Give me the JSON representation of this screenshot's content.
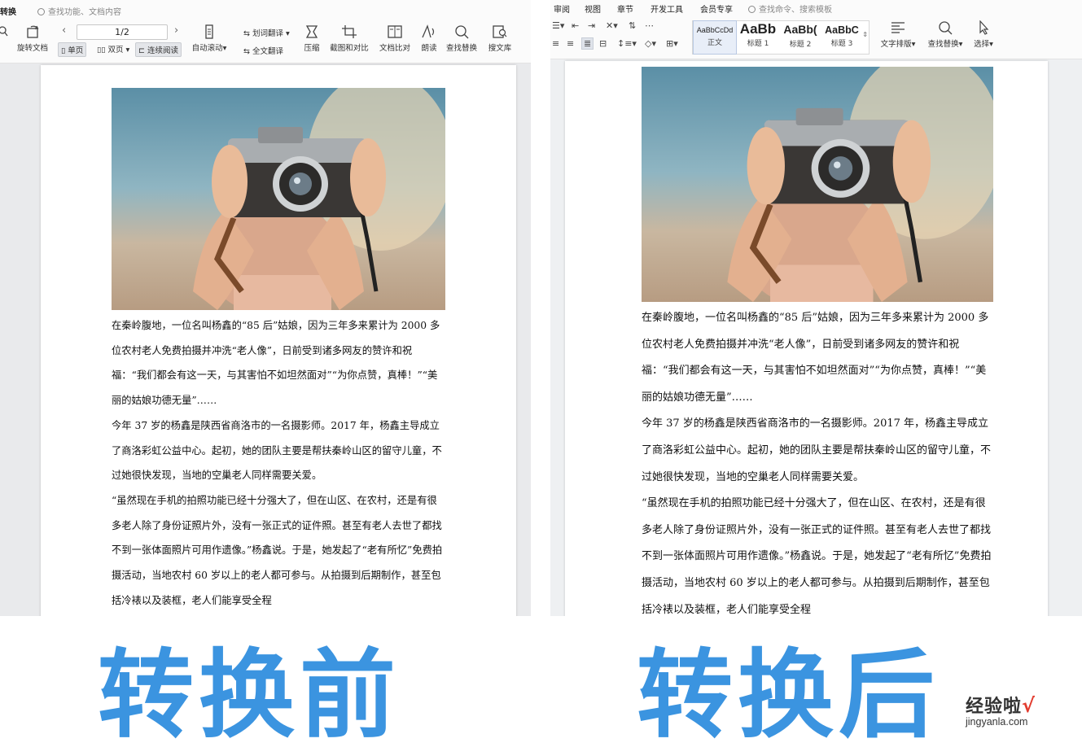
{
  "left": {
    "menu": {
      "convert_tab": "转换"
    },
    "search": {
      "placeholder": "查找功能、文档内容"
    },
    "page_indicator": "1/2",
    "tools": {
      "rotate": "旋转文档",
      "single_page": "单页",
      "double_page": "双页",
      "continuous": "连续阅读",
      "auto_scroll": "自动滚动",
      "word_translate": "划词翻译",
      "full_translate": "全文翻译",
      "compress": "压缩",
      "screenshot_compare": "截图和对比",
      "doc_compare": "文档比对",
      "read_aloud": "朗读",
      "find_replace": "查找替换",
      "search_library": "搜文库"
    },
    "icons": [
      "zoom-icon",
      "rotate-doc-icon",
      "prev-page-icon",
      "next-page-icon",
      "single-page-icon",
      "double-page-icon",
      "continuous-read-icon",
      "auto-scroll-icon",
      "word-translate-icon",
      "full-translate-icon",
      "compress-icon",
      "screenshot-compare-icon",
      "doc-compare-icon",
      "read-aloud-icon",
      "find-replace-icon",
      "search-library-icon"
    ]
  },
  "right": {
    "menu": {
      "review": "审阅",
      "view": "视图",
      "chapter": "章节",
      "developer": "开发工具",
      "member": "会员专享"
    },
    "search": {
      "placeholder": "查找命令、搜索模板"
    },
    "styles": [
      {
        "sample": "AaBbCcDd",
        "name": "正文"
      },
      {
        "sample": "AaBb",
        "name": "标题 1"
      },
      {
        "sample": "AaBb(",
        "name": "标题 2"
      },
      {
        "sample": "AaBbC",
        "name": "标题 3"
      }
    ],
    "tools": {
      "text_layout": "文字排版",
      "find_replace": "查找替换",
      "select": "选择"
    },
    "icons": [
      "bullet-list-icon",
      "numbered-list-icon",
      "decrease-indent-icon",
      "increase-indent-icon",
      "chinese-layout-icon",
      "sort-icon",
      "show-marks-icon",
      "align-left-icon",
      "align-center-icon",
      "align-right-icon",
      "justify-icon",
      "distributed-icon",
      "line-spacing-icon",
      "shading-icon",
      "border-icon",
      "text-layout-icon",
      "find-replace-icon",
      "select-cursor-icon"
    ]
  },
  "document": {
    "paragraphs": [
      "在秦岭腹地，一位名叫杨鑫的“85 后”姑娘，因为三年多来累计为 2000 多位农村老人免费拍摄并冲洗“老人像”，日前受到诸多网友的赞许和祝福：“我们都会有这一天，与其害怕不如坦然面对”“为你点赞，真棒！”“美丽的姑娘功德无量”……",
      "今年 37 岁的杨鑫是陕西省商洛市的一名摄影师。2017 年，杨鑫主导成立了商洛彩虹公益中心。起初，她的团队主要是帮扶秦岭山区的留守儿童，不过她很快发现，当地的空巢老人同样需要关爱。",
      "“虽然现在手机的拍照功能已经十分强大了，但在山区、在农村，还是有很多老人除了身份证照片外，没有一张正式的证件照。甚至有老人去世了都找不到一张体面照片可用作遗像。”杨鑫说。于是，她发起了“老有所忆”免费拍摄活动，当地农村 60 岁以上的老人都可参与。从拍摄到后期制作，甚至包括冷裱以及装框，老人们能享受全程"
    ],
    "photo_subject": "woman-holding-camera"
  },
  "captions": {
    "before": "转换前",
    "after": "转换后"
  },
  "watermark": {
    "name": "经验啦",
    "check": "√",
    "url": "jingyanla.com"
  },
  "colors": {
    "caption": "#3b94e0",
    "watermark_check": "#e23b2e",
    "toolbar_bg": "#fbfbfb"
  }
}
